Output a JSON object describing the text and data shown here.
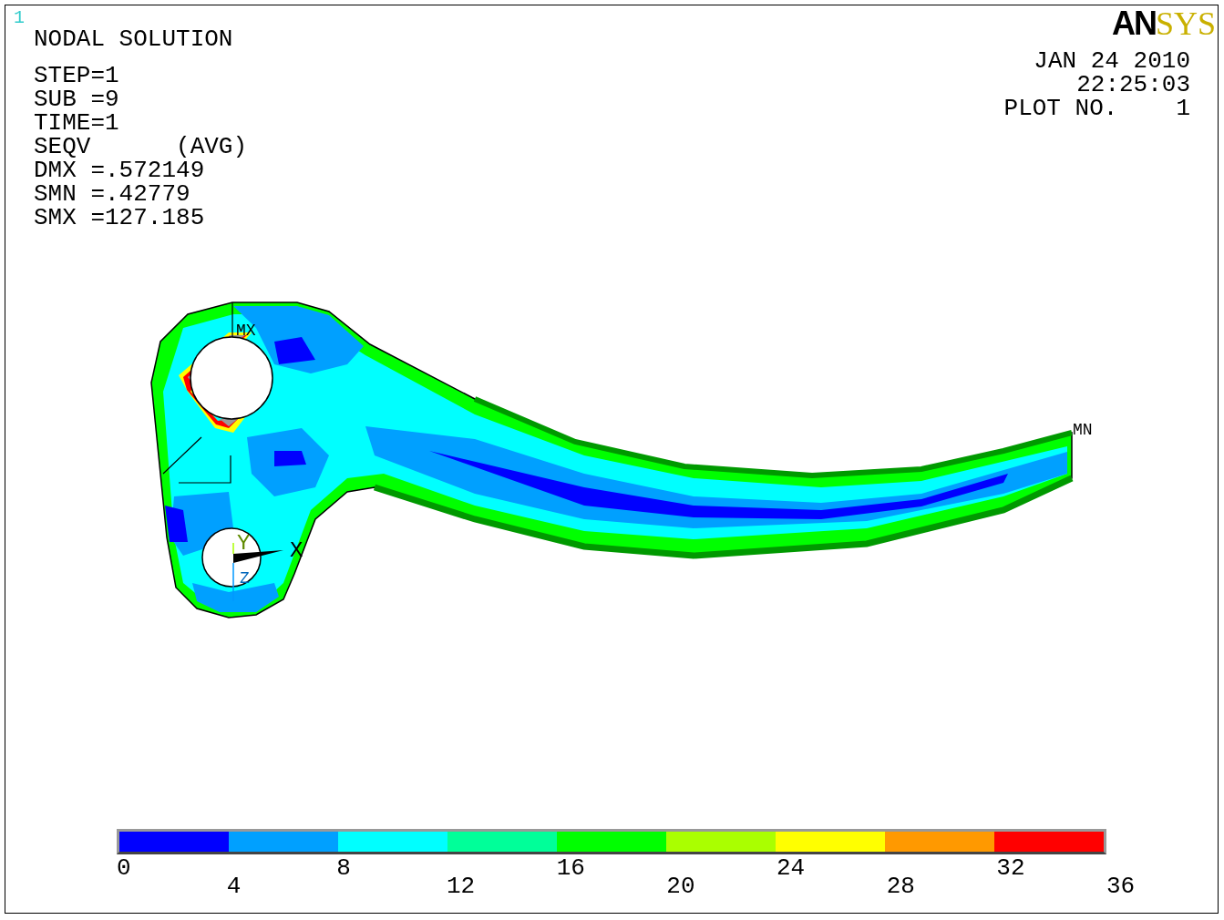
{
  "window_number": "1",
  "title": "NODAL SOLUTION",
  "info_lines": [
    "STEP=1",
    "SUB =9",
    "TIME=1",
    "SEQV      (AVG)",
    "DMX =.572149",
    "SMN =.42779",
    "SMX =127.185"
  ],
  "logo": {
    "dark": "AN",
    "light": "SYS"
  },
  "date": "JAN 24 2010",
  "time": "22:25:03",
  "plot_label": "PLOT NO.",
  "plot_number": "1",
  "markers": {
    "max": "MX",
    "min": "MN"
  },
  "axes": {
    "x": "X",
    "y": "Y",
    "z": "Z"
  },
  "legend": {
    "bands": [
      {
        "color": "#0000ff"
      },
      {
        "color": "#00a0ff"
      },
      {
        "color": "#00ffff"
      },
      {
        "color": "#00ff99"
      },
      {
        "color": "#00ff00"
      },
      {
        "color": "#aaff00"
      },
      {
        "color": "#ffff00"
      },
      {
        "color": "#ff9900"
      },
      {
        "color": "#ff0000"
      }
    ],
    "labels": [
      "0",
      "4",
      "8",
      "12",
      "16",
      "20",
      "24",
      "28",
      "32",
      "36"
    ]
  }
}
